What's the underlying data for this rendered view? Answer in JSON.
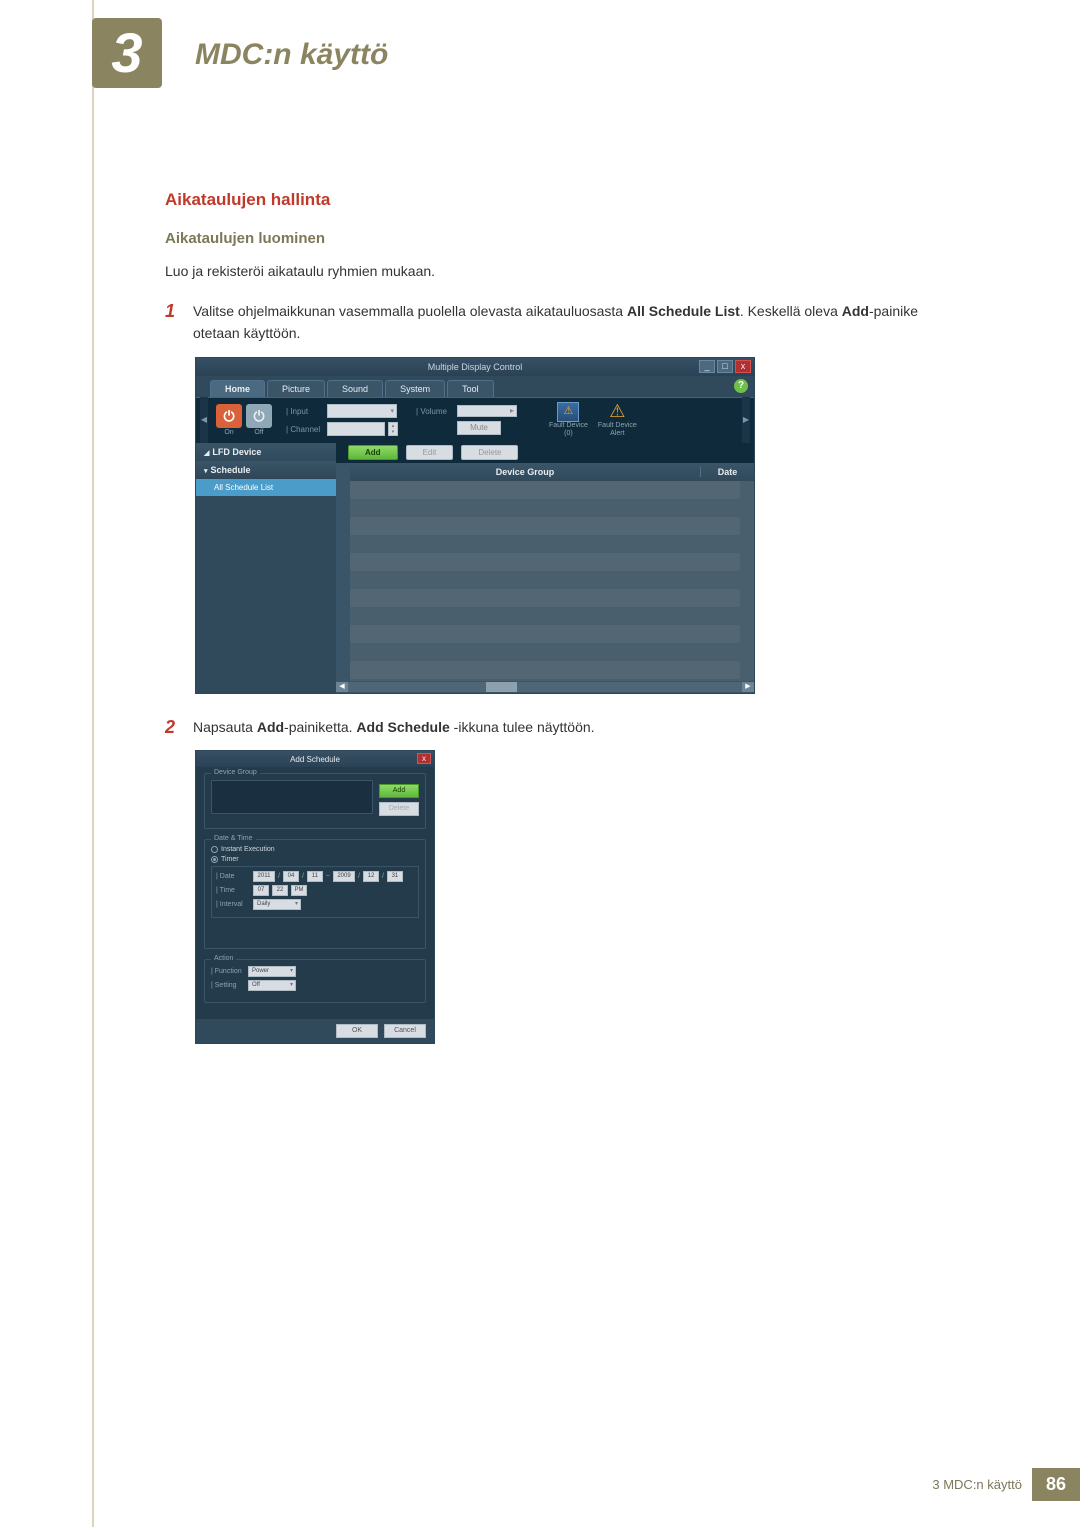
{
  "chapter": {
    "number": "3",
    "title": "MDC:n käyttö"
  },
  "section": {
    "h1": "Aikataulujen hallinta",
    "h2": "Aikataulujen luominen",
    "intro": "Luo ja rekisteröi aikataulu ryhmien mukaan."
  },
  "steps": [
    {
      "num": "1",
      "pre": "Valitse ohjelmaikkunan vasemmalla puolella olevasta aikatauluosasta ",
      "b1": "All Schedule List",
      "mid": ". Keskellä oleva ",
      "b2": "Add",
      "post": "-painike otetaan käyttöön."
    },
    {
      "num": "2",
      "pre": "Napsauta ",
      "b1": "Add",
      "mid": "-painiketta. ",
      "b2": "Add Schedule",
      "post": " -ikkuna tulee näyttöön."
    }
  ],
  "mdc": {
    "title": "Multiple Display Control",
    "win": {
      "min": "_",
      "max": "□",
      "close": "x"
    },
    "tabs": {
      "home": "Home",
      "picture": "Picture",
      "sound": "Sound",
      "system": "System",
      "tool": "Tool"
    },
    "help": "?",
    "toolbar": {
      "on": "On",
      "off": "Off",
      "input": "Input",
      "channel": "Channel",
      "volume": "Volume",
      "mute": "Mute",
      "fault0": "Fault Device",
      "fault0_sub": "(0)",
      "alert": "Fault Device",
      "alert_sub": "Alert"
    },
    "tree": {
      "lfd": "LFD Device",
      "schedule": "Schedule",
      "all": "All Schedule List"
    },
    "actions": {
      "add": "Add",
      "edit": "Edit",
      "delete": "Delete"
    },
    "grid": {
      "group": "Device Group",
      "date": "Date"
    }
  },
  "schedDlg": {
    "title": "Add Schedule",
    "deviceGroup": "Device Group",
    "add": "Add",
    "delete": "Delete",
    "dateTime": "Date & Time",
    "instant": "Instant Execution",
    "timer": "Timer",
    "date": "Date",
    "dateFrom": {
      "y": "2011",
      "m": "04",
      "d": "11"
    },
    "dateTo": {
      "y": "2009",
      "m": "12",
      "d": "31"
    },
    "tilde": "~",
    "time": "Time",
    "timeVal": {
      "h": "07",
      "m": "22",
      "ap": "PM"
    },
    "interval": "Interval",
    "intervalVal": "Daily",
    "action": "Action",
    "function": "Function",
    "functionVal": "Power",
    "setting": "Setting",
    "settingVal": "Off",
    "ok": "OK",
    "cancel": "Cancel"
  },
  "footer": {
    "label": "3 MDC:n käyttö",
    "page": "86"
  }
}
